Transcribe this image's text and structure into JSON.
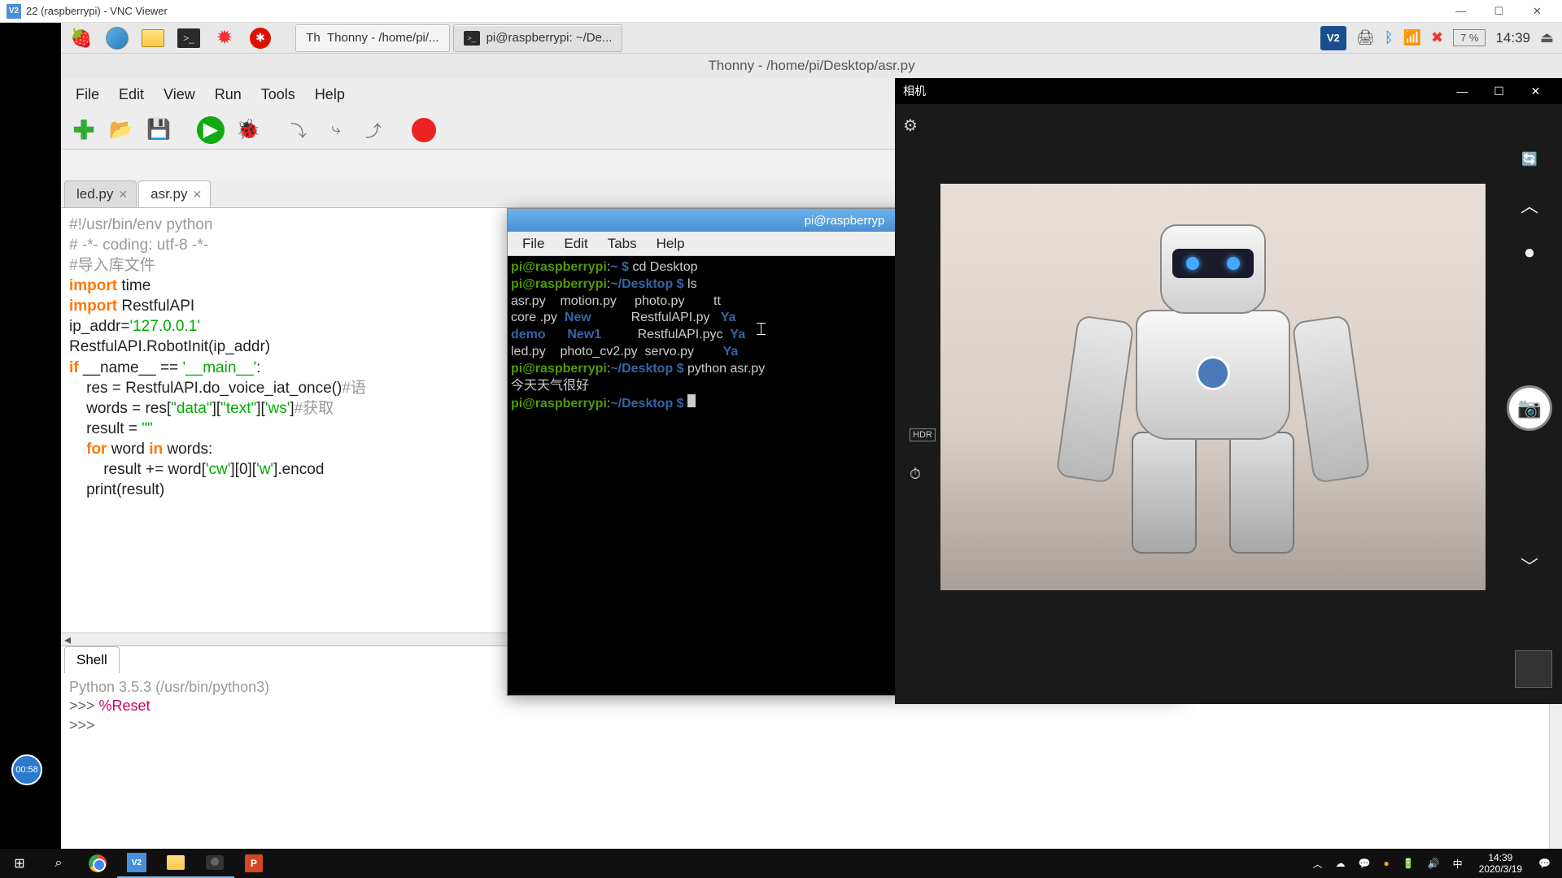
{
  "vnc": {
    "title": "22 (raspberrypi) - VNC Viewer"
  },
  "rpi_taskbar": {
    "apps": [
      {
        "label": "Thonny  -  /home/pi/..."
      },
      {
        "label": "pi@raspberrypi: ~/De..."
      }
    ],
    "battery": "7 %",
    "clock": "14:39"
  },
  "thonny": {
    "title": "Thonny  -  /home/pi/Desktop/asr.py",
    "menu": [
      "File",
      "Edit",
      "View",
      "Run",
      "Tools",
      "Help"
    ],
    "tabs": [
      {
        "name": "led.py"
      },
      {
        "name": "asr.py"
      }
    ],
    "code_lines": [
      {
        "t": "#!/usr/bin/env python",
        "cls": "comment"
      },
      {
        "t": "# -*- coding: utf-8 -*-",
        "cls": "comment"
      },
      {
        "t": "#导入库文件",
        "cls": "comment"
      },
      {
        "html": "<span class='kw'>import</span> time"
      },
      {
        "html": "<span class='kw'>import</span> RestfulAPI"
      },
      {
        "t": ""
      },
      {
        "html": "ip_addr=<span class='str'>'127.0.0.1'</span>"
      },
      {
        "t": "RestfulAPI.RobotInit(ip_addr)"
      },
      {
        "t": ""
      },
      {
        "html": "<span class='kw'>if</span> __name__ == <span class='str'>'__main__'</span>:"
      },
      {
        "html": "    res = RestfulAPI.do_voice_iat_once()<span class='comment'>#语</span>"
      },
      {
        "html": "    words = res[<span class='str'>\"data\"</span>][<span class='str'>\"text\"</span>][<span class='str'>'ws'</span>]<span class='comment'>#获取</span>"
      },
      {
        "html": "    result = <span class='str'>\"\"</span>"
      },
      {
        "html": "    <span class='kw'>for</span> word <span class='kw'>in</span> words:"
      },
      {
        "html": "        result += word[<span class='str'>'cw'</span>][0][<span class='str'>'w'</span>].encod"
      },
      {
        "t": "    print(result)"
      }
    ],
    "shell": {
      "tab": "Shell",
      "lines": [
        {
          "html": "<span class='info'>Python 3.5.3 (/usr/bin/python3)</span>"
        },
        {
          "html": "<span class='prompt'>>>> </span><span class='magic'>%Reset</span>"
        },
        {
          "html": "<span class='prompt'>>>> </span>"
        }
      ]
    }
  },
  "terminal": {
    "title": "pi@raspberryp",
    "menu": [
      "File",
      "Edit",
      "Tabs",
      "Help"
    ],
    "lines": [
      {
        "html": "<span class='user'>pi@raspberrypi</span>:<span class='path'>~ $</span> cd Desktop"
      },
      {
        "html": "<span class='user'>pi@raspberrypi</span>:<span class='path'>~/Desktop $</span> ls"
      },
      {
        "html": "asr.py    motion.py     photo.py        tt"
      },
      {
        "html": "core .py  <span class='dir'>New</span>           RestfulAPI.py   <span class='dir'>Ya</span>"
      },
      {
        "html": "<span class='dir'>demo</span>      <span class='dir'>New1</span>          RestfulAPI.pyc  <span class='dir'>Ya</span>"
      },
      {
        "html": "led.py    photo_cv2.py  servo.py        <span class='dir'>Ya</span>"
      },
      {
        "html": "<span class='user'>pi@raspberrypi</span>:<span class='path'>~/Desktop $</span> python asr.py"
      },
      {
        "html": "今天天气很好"
      },
      {
        "html": "<span class='user'>pi@raspberrypi</span>:<span class='path'>~/Desktop $</span> <span class='cursor'></span>"
      }
    ]
  },
  "camera": {
    "title": "相机"
  },
  "time_badge": "00:58",
  "windows_taskbar": {
    "time": "14:39",
    "date": "2020/3/19"
  }
}
